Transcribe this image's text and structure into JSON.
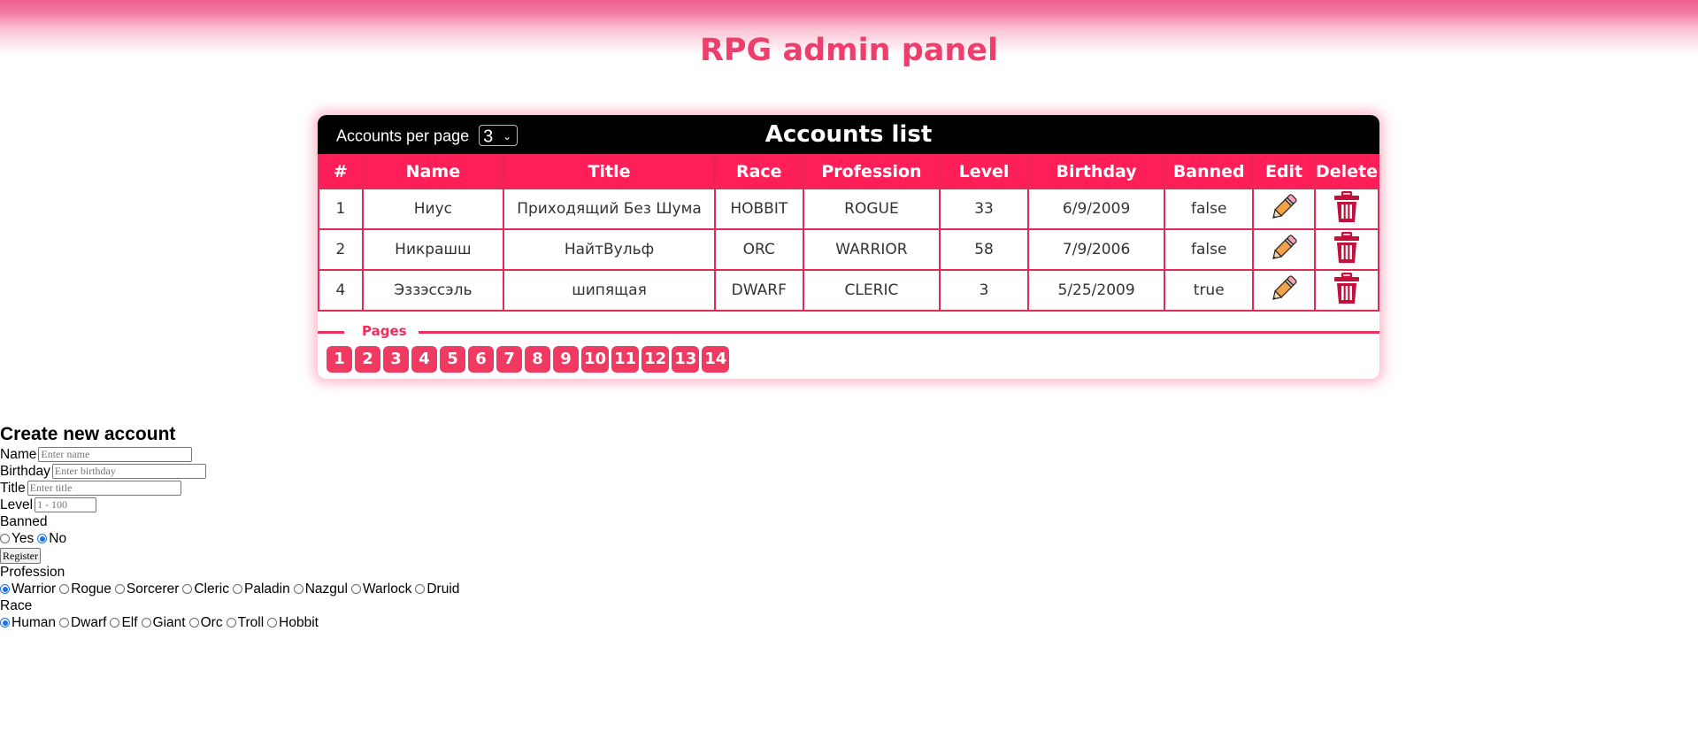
{
  "header": {
    "title": "RPG admin panel"
  },
  "accounts": {
    "per_page_label": "Accounts per page",
    "per_page_value": "3",
    "title": "Accounts list",
    "columns": [
      "#",
      "Name",
      "Title",
      "Race",
      "Profession",
      "Level",
      "Birthday",
      "Banned",
      "Edit",
      "Delete"
    ],
    "rows": [
      {
        "id": "1",
        "name": "Ниус",
        "title": "Приходящий Без Шума",
        "race": "HOBBIT",
        "profession": "ROGUE",
        "level": "33",
        "birthday": "6/9/2009",
        "banned": "false"
      },
      {
        "id": "2",
        "name": "Никрашш",
        "title": "НайтВульф",
        "race": "ORC",
        "profession": "WARRIOR",
        "level": "58",
        "birthday": "7/9/2006",
        "banned": "false"
      },
      {
        "id": "4",
        "name": "Эззэссэль",
        "title": "шипящая",
        "race": "DWARF",
        "profession": "CLERIC",
        "level": "3",
        "birthday": "5/25/2009",
        "banned": "true"
      }
    ],
    "pages_label": "Pages",
    "pages": [
      "1",
      "2",
      "3",
      "4",
      "5",
      "6",
      "7",
      "8",
      "9",
      "10",
      "11",
      "12",
      "13",
      "14"
    ]
  },
  "form": {
    "title": "Create new account",
    "name_label": "Name",
    "name_placeholder": "Enter name",
    "birthday_label": "Birthday",
    "birthday_placeholder": "Enter birthday",
    "title_label": "Title",
    "title_placeholder": "Enter title",
    "level_label": "Level",
    "level_placeholder": "1 - 100",
    "banned_label": "Banned",
    "banned_options": [
      {
        "label": "Yes",
        "checked": false
      },
      {
        "label": "No",
        "checked": true
      }
    ],
    "register_label": "Register",
    "profession_label": "Profession",
    "professions": [
      {
        "label": "Warrior",
        "checked": true
      },
      {
        "label": "Rogue",
        "checked": false
      },
      {
        "label": "Sorcerer",
        "checked": false
      },
      {
        "label": "Cleric",
        "checked": false
      },
      {
        "label": "Paladin",
        "checked": false
      },
      {
        "label": "Nazgul",
        "checked": false
      },
      {
        "label": "Warlock",
        "checked": false
      },
      {
        "label": "Druid",
        "checked": false
      }
    ],
    "race_label": "Race",
    "races": [
      {
        "label": "Human",
        "checked": true
      },
      {
        "label": "Dwarf",
        "checked": false
      },
      {
        "label": "Elf",
        "checked": false
      },
      {
        "label": "Giant",
        "checked": false
      },
      {
        "label": "Orc",
        "checked": false
      },
      {
        "label": "Troll",
        "checked": false
      },
      {
        "label": "Hobbit",
        "checked": false
      }
    ]
  },
  "colors": {
    "accent": "#ff1f58",
    "title": "#ee3e6b",
    "trash": "#c4113c",
    "pencil": "#f4a24a"
  },
  "icons": {
    "edit": "pencil-icon",
    "delete": "trash-icon"
  }
}
